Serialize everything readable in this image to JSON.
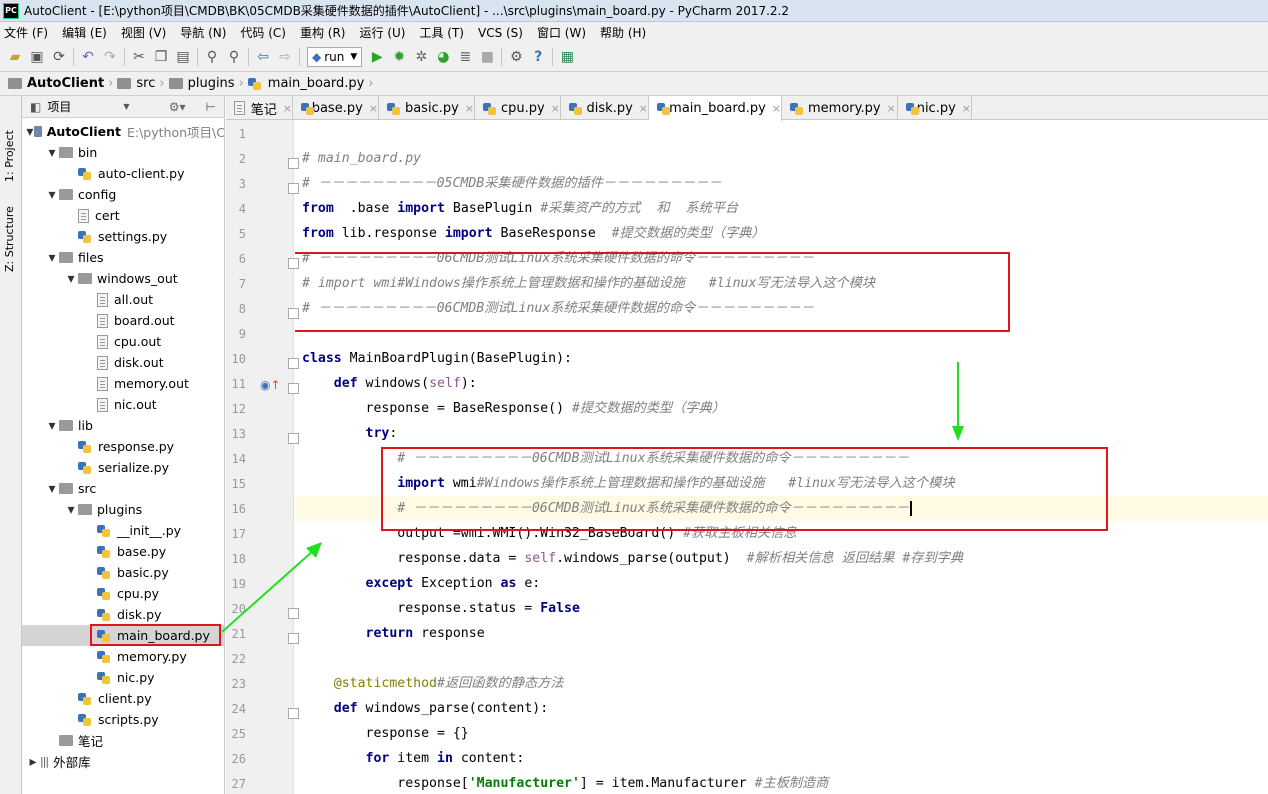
{
  "window": {
    "title": "AutoClient - [E:\\python项目\\CMDB\\BK\\05CMDB采集硬件数据的插件\\AutoClient] - ...\\src\\plugins\\main_board.py - PyCharm 2017.2.2",
    "logo": "PC"
  },
  "menu": [
    "文件 (F)",
    "编辑 (E)",
    "视图 (V)",
    "导航 (N)",
    "代码 (C)",
    "重构 (R)",
    "运行 (U)",
    "工具 (T)",
    "VCS (S)",
    "窗口 (W)",
    "帮助 (H)"
  ],
  "toolbar": {
    "run_config": "run"
  },
  "breadcrumb": [
    "AutoClient",
    "src",
    "plugins",
    "main_board.py"
  ],
  "side_tabs": {
    "project": "1: Project",
    "structure": "Z: Structure"
  },
  "project_panel": {
    "title": "项目"
  },
  "tree": [
    {
      "label": "AutoClient",
      "extra": "E:\\python项目\\C",
      "kind": "root",
      "depth": 0,
      "open": true
    },
    {
      "label": "bin",
      "kind": "folder",
      "depth": 1,
      "open": true
    },
    {
      "label": "auto-client.py",
      "kind": "py",
      "depth": 2
    },
    {
      "label": "config",
      "kind": "folder",
      "depth": 1,
      "open": true
    },
    {
      "label": "cert",
      "kind": "txt",
      "depth": 2
    },
    {
      "label": "settings.py",
      "kind": "py",
      "depth": 2
    },
    {
      "label": "files",
      "kind": "folder",
      "depth": 1,
      "open": true
    },
    {
      "label": "windows_out",
      "kind": "folder",
      "depth": 2,
      "open": true
    },
    {
      "label": "all.out",
      "kind": "txt",
      "depth": 3
    },
    {
      "label": "board.out",
      "kind": "txt",
      "depth": 3
    },
    {
      "label": "cpu.out",
      "kind": "txt",
      "depth": 3
    },
    {
      "label": "disk.out",
      "kind": "txt",
      "depth": 3
    },
    {
      "label": "memory.out",
      "kind": "txt",
      "depth": 3
    },
    {
      "label": "nic.out",
      "kind": "txt",
      "depth": 3
    },
    {
      "label": "lib",
      "kind": "folder",
      "depth": 1,
      "open": true
    },
    {
      "label": "response.py",
      "kind": "py",
      "depth": 2
    },
    {
      "label": "serialize.py",
      "kind": "py",
      "depth": 2
    },
    {
      "label": "src",
      "kind": "folder",
      "depth": 1,
      "open": true
    },
    {
      "label": "plugins",
      "kind": "folder",
      "depth": 2,
      "open": true
    },
    {
      "label": "__init__.py",
      "kind": "py",
      "depth": 3
    },
    {
      "label": "base.py",
      "kind": "py",
      "depth": 3
    },
    {
      "label": "basic.py",
      "kind": "py",
      "depth": 3
    },
    {
      "label": "cpu.py",
      "kind": "py",
      "depth": 3
    },
    {
      "label": "disk.py",
      "kind": "py",
      "depth": 3
    },
    {
      "label": "main_board.py",
      "kind": "py",
      "depth": 3,
      "selected": true
    },
    {
      "label": "memory.py",
      "kind": "py",
      "depth": 3
    },
    {
      "label": "nic.py",
      "kind": "py",
      "depth": 3
    },
    {
      "label": "client.py",
      "kind": "py",
      "depth": 2
    },
    {
      "label": "scripts.py",
      "kind": "py",
      "depth": 2
    },
    {
      "label": "笔记",
      "kind": "folder",
      "depth": 1
    },
    {
      "label": "外部库",
      "kind": "lib",
      "depth": 0,
      "open": false
    }
  ],
  "tabs": [
    {
      "label": "笔记",
      "kind": "txt"
    },
    {
      "label": "base.py",
      "kind": "py"
    },
    {
      "label": "basic.py",
      "kind": "py"
    },
    {
      "label": "cpu.py",
      "kind": "py"
    },
    {
      "label": "disk.py",
      "kind": "py"
    },
    {
      "label": "main_board.py",
      "kind": "py",
      "active": true
    },
    {
      "label": "memory.py",
      "kind": "py"
    },
    {
      "label": "nic.py",
      "kind": "py"
    }
  ],
  "line_numbers": [
    "1",
    "2",
    "3",
    "4",
    "5",
    "6",
    "7",
    "8",
    "9",
    "10",
    "11",
    "12",
    "13",
    "14",
    "15",
    "16",
    "17",
    "18",
    "19",
    "20",
    "21",
    "22",
    "23",
    "24",
    "25",
    "26",
    "27"
  ],
  "code": [
    [],
    [
      [
        "cm",
        "# main_board.py"
      ]
    ],
    [
      [
        "cm",
        "# －－－－－－－－－05CMDB采集硬件数据的插件－－－－－－－－－"
      ]
    ],
    [
      [
        "kw",
        "from"
      ],
      [
        "",
        "  .base "
      ],
      [
        "kw",
        "import"
      ],
      [
        "",
        " BasePlugin "
      ],
      [
        "cm",
        "#采集资产的方式  和  系统平台"
      ]
    ],
    [
      [
        "kw",
        "from"
      ],
      [
        "",
        " lib.response "
      ],
      [
        "kw",
        "import"
      ],
      [
        "",
        " BaseResponse  "
      ],
      [
        "cm",
        "#提交数据的类型（字典）"
      ]
    ],
    [
      [
        "cm",
        "# －－－－－－－－－06CMDB测试Linux系统采集硬件数据的命令－－－－－－－－－"
      ]
    ],
    [
      [
        "cm",
        "# import wmi#Windows操作系统上管理数据和操作的基础设施   #linux写无法导入这个模块"
      ]
    ],
    [
      [
        "cm",
        "# －－－－－－－－－06CMDB测试Linux系统采集硬件数据的命令－－－－－－－－－"
      ]
    ],
    [],
    [
      [
        "kw",
        "class"
      ],
      [
        "",
        " MainBoardPlugin(BasePlugin):"
      ]
    ],
    [
      [
        "",
        "    "
      ],
      [
        "kw",
        "def"
      ],
      [
        "",
        " windows("
      ],
      [
        "sf",
        "self"
      ],
      [
        "",
        "):"
      ]
    ],
    [
      [
        "",
        "        response = BaseResponse() "
      ],
      [
        "cm",
        "#提交数据的类型（字典）"
      ]
    ],
    [
      [
        "",
        "        "
      ],
      [
        "kw",
        "try"
      ],
      [
        "",
        ":"
      ]
    ],
    [
      [
        "",
        "            "
      ],
      [
        "cm",
        "# －－－－－－－－－06CMDB测试Linux系统采集硬件数据的命令－－－－－－－－－"
      ]
    ],
    [
      [
        "",
        "            "
      ],
      [
        "kw",
        "import"
      ],
      [
        "",
        " wmi"
      ],
      [
        "cm",
        "#Windows操作系统上管理数据和操作的基础设施   #linux写无法导入这个模块"
      ]
    ],
    [
      [
        "",
        "            "
      ],
      [
        "cm",
        "# －－－－－－－－－06CMDB测试Linux系统采集硬件数据的命令－－－－－－－－－"
      ]
    ],
    [
      [
        "",
        "            output =wmi.WMI().Win32_BaseBoard() "
      ],
      [
        "cm",
        "#获取主板相关信息"
      ]
    ],
    [
      [
        "",
        "            response.data = "
      ],
      [
        "sf",
        "self"
      ],
      [
        "",
        ".windows_parse(output)  "
      ],
      [
        "cm",
        "#解析相关信息 返回结果 #存到字典"
      ]
    ],
    [
      [
        "",
        "        "
      ],
      [
        "kw",
        "except"
      ],
      [
        "",
        " Exception "
      ],
      [
        "kw",
        "as"
      ],
      [
        "",
        " e:"
      ]
    ],
    [
      [
        "",
        "            response.status = "
      ],
      [
        "kw",
        "False"
      ]
    ],
    [
      [
        "",
        "        "
      ],
      [
        "kw",
        "return"
      ],
      [
        "",
        " response"
      ]
    ],
    [],
    [
      [
        "",
        "    "
      ],
      [
        "dec",
        "@staticmethod"
      ],
      [
        "cm",
        "#返回函数的静态方法"
      ]
    ],
    [
      [
        "",
        "    "
      ],
      [
        "kw",
        "def"
      ],
      [
        "",
        " windows_parse(content):"
      ]
    ],
    [
      [
        "",
        "        response = {}"
      ]
    ],
    [
      [
        "",
        "        "
      ],
      [
        "kw",
        "for"
      ],
      [
        "",
        " item "
      ],
      [
        "kw",
        "in"
      ],
      [
        "",
        " content:"
      ]
    ],
    [
      [
        "",
        "            response["
      ],
      [
        "st",
        "'Manufacturer'"
      ],
      [
        "",
        "] = item.Manufacturer "
      ],
      [
        "cm",
        "#主板制造商"
      ]
    ]
  ]
}
